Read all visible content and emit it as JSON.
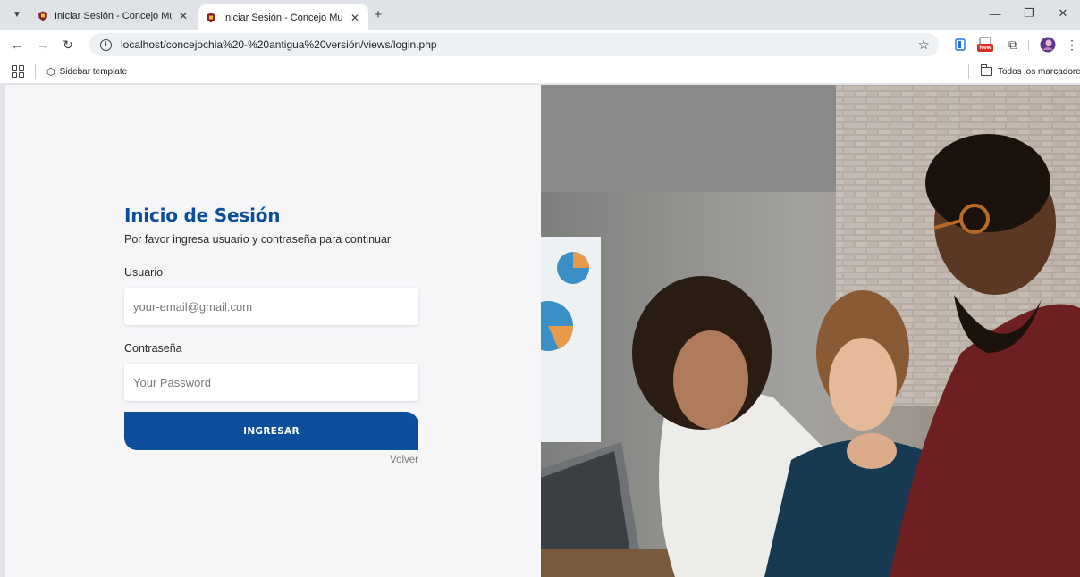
{
  "browser": {
    "tabs": [
      {
        "title": "Iniciar Sesión - Concejo Municip",
        "active": false
      },
      {
        "title": "Iniciar Sesión - Concejo Municip",
        "active": true
      }
    ],
    "address_bar": {
      "url": "localhost/concejochia%20-%20antigua%20versión/views/login.php"
    },
    "bookmarks": [
      {
        "label": "Sidebar template",
        "icon": "codepen-icon"
      }
    ],
    "all_bookmarks_label": "Todos los marcadores",
    "extensions": [
      "extension-icon",
      "new-badge-extension-icon",
      "puzzle-icon",
      "avatar"
    ]
  },
  "login": {
    "title": "Inicio de Sesión",
    "subtitle": "Por favor ingresa usuario y contraseña para continuar",
    "user_label": "Usuario",
    "user_placeholder": "your-email@gmail.com",
    "password_label": "Contraseña",
    "password_placeholder": "Your Password",
    "submit_label": "INGRESAR",
    "back_label": "Volver"
  },
  "extension_badge": "New",
  "colors": {
    "brand_blue": "#0b4f9c",
    "page_bg": "#f6f6f9",
    "browser_frame": "#dfe3e8"
  }
}
